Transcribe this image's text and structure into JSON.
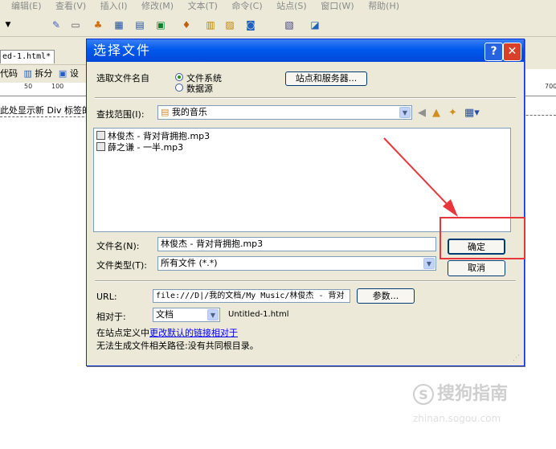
{
  "app": {
    "menu": [
      "编辑(E)",
      "查看(V)",
      "插入(I)",
      "修改(M)",
      "文本(T)",
      "命令(C)",
      "站点(S)",
      "窗口(W)",
      "帮助(H)"
    ],
    "doc_tab": "ed-1.html*",
    "view_buttons": [
      "代码",
      "拆分",
      "设"
    ],
    "ruler_ticks": [
      "50",
      "100",
      "700"
    ],
    "div_hint": "此处显示新 Div 标签的"
  },
  "dialog": {
    "title": "选择文件",
    "help_glyph": "?",
    "close_glyph": "✕",
    "select_from_label": "选取文件名自",
    "radio_filesystem": "文件系统",
    "radio_datasource": "数据源",
    "sites_button": "站点和服务器...",
    "lookin_label": "查找范围(I):",
    "lookin_value": "我的音乐",
    "files": [
      "林俊杰 - 背对背拥抱.mp3",
      "薛之谦 - 一半.mp3"
    ],
    "filename_label": "文件名(N):",
    "filename_value": "林俊杰 - 背对背拥抱.mp3",
    "filetype_label": "文件类型(T):",
    "filetype_value": "所有文件 (*.*)",
    "ok_button": "确定",
    "cancel_button": "取消",
    "url_label": "URL:",
    "url_value": "file:///D|/我的文档/My Music/林俊杰 - 背对",
    "params_button": "参数...",
    "relative_label": "相对于:",
    "relative_value": "文档",
    "relative_doc": "Untitled-1.html",
    "site_def_prefix": "在站点定义中",
    "site_def_link": "更改默认的链接相对于",
    "warning": "无法生成文件相关路径:没有共同根目录。"
  },
  "watermark": {
    "logo": "S",
    "text": "搜狗指南",
    "sub": "zhinan.sogou.com"
  },
  "colors": {
    "title_bar": "#0058ee",
    "dialog_bg": "#ece9d8",
    "highlight_box": "#e8373c",
    "arrow": "#e8373c"
  }
}
